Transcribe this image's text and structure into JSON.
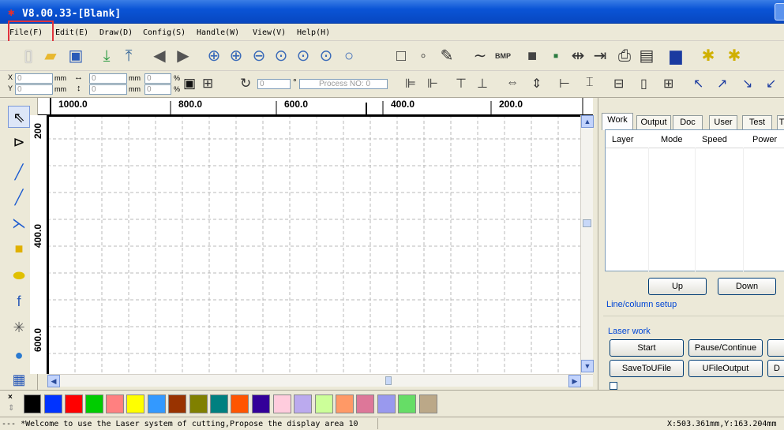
{
  "window": {
    "title": "V8.00.33-[Blank]"
  },
  "menu": [
    "File(F)",
    "Edit(E)",
    "Draw(D)",
    "Config(S)",
    "Handle(W)",
    "View(V)",
    "Help(H)"
  ],
  "coords": {
    "x_label": "X",
    "y_label": "Y",
    "x_value": "0",
    "y_value": "0",
    "w_value": "0",
    "h_value": "0",
    "sx_value": "0",
    "sy_value": "0",
    "unit": "mm",
    "pct": "%",
    "rotate_value": "0",
    "degree": "°",
    "process_placeholder": "Process NO:",
    "process_value": "0"
  },
  "ruler": {
    "h_labels": [
      "1000.0",
      "800.0",
      "600.0",
      "400.0",
      "200.0"
    ],
    "v_labels": [
      "200",
      "400.0",
      "600.0"
    ]
  },
  "right_panel": {
    "tabs": [
      "Work",
      "Output",
      "Doc",
      "User",
      "Test",
      "T"
    ],
    "columns": [
      "Layer",
      "Mode",
      "Speed",
      "Power"
    ],
    "up": "Up",
    "down": "Down",
    "line_setup": "Line/column setup",
    "laser_work": "Laser work",
    "start": "Start",
    "pause": "Pause/Continue",
    "save_ufile": "SaveToUFile",
    "ufile_output": "UFileOutput",
    "d_btn": "D"
  },
  "palette": {
    "colors": [
      "#000000",
      "#0033ff",
      "#ff0000",
      "#00cc00",
      "#ff8080",
      "#ffff00",
      "#3399ff",
      "#993300",
      "#808000",
      "#008080",
      "#ff5500",
      "#330099",
      "#ffccdd",
      "#bbaaee",
      "#ccff99",
      "#ff9966",
      "#dd7799",
      "#9999ee",
      "#66dd66",
      "#bba888"
    ]
  },
  "status": {
    "message": "--- *Welcome to use the Laser system of cutting,Propose the display area 10",
    "position": "X:503.361mm,Y:163.204mm"
  },
  "colors": {
    "accent": "#0a54d6",
    "highlight": "#e0343c"
  }
}
